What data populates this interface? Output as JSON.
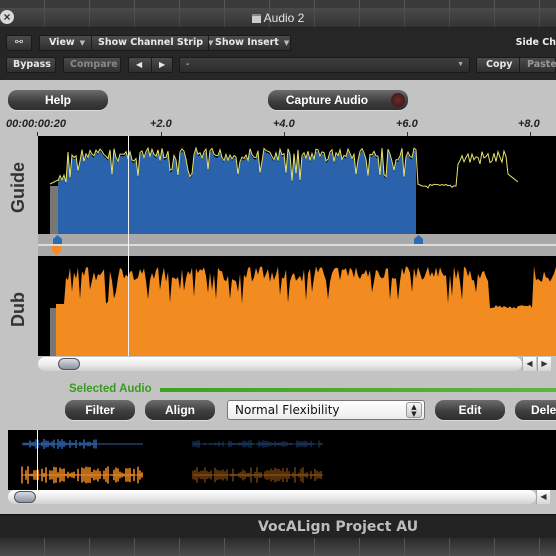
{
  "window": {
    "title": "Audio 2",
    "close_icon": "close-circle-icon",
    "title_icon": "audio-track-icon"
  },
  "toolbar": {
    "link_icon": "link-icon",
    "view_label": "View",
    "channel_strip_label": "Show Channel Strip",
    "show_insert_label": "Show Insert",
    "side_chain_label": "Side Ch",
    "bypass_label": "Bypass",
    "compare_label": "Compare",
    "prev_icon": "◀",
    "next_icon": "▶",
    "preset_value": "-",
    "copy_label": "Copy",
    "paste_label": "Paste",
    "dropdown_arrow": "▼"
  },
  "plugin": {
    "help_label": "Help",
    "capture_label": "Capture Audio",
    "capture_active": false,
    "ruler": {
      "start_time": "00:00:00:20",
      "ticks": [
        "+2.0",
        "+4.0",
        "+6.0",
        "+8.0"
      ]
    },
    "guide_label": "Guide",
    "dub_label": "Dub",
    "colors": {
      "guide": "#2a63ab",
      "guide_envelope": "#e8e26a",
      "dub": "#f28c21",
      "selected_audio": "#3ca41e"
    },
    "selected_audio_label": "Selected Audio",
    "filter_label": "Filter",
    "align_label": "Align",
    "flexibility_value": "Normal Flexibility",
    "edit_label": "Edit",
    "delete_label": "Dele",
    "scroll_left": "◀",
    "scroll_right": "▶"
  },
  "footer": {
    "title": "VocALign Project AU"
  }
}
